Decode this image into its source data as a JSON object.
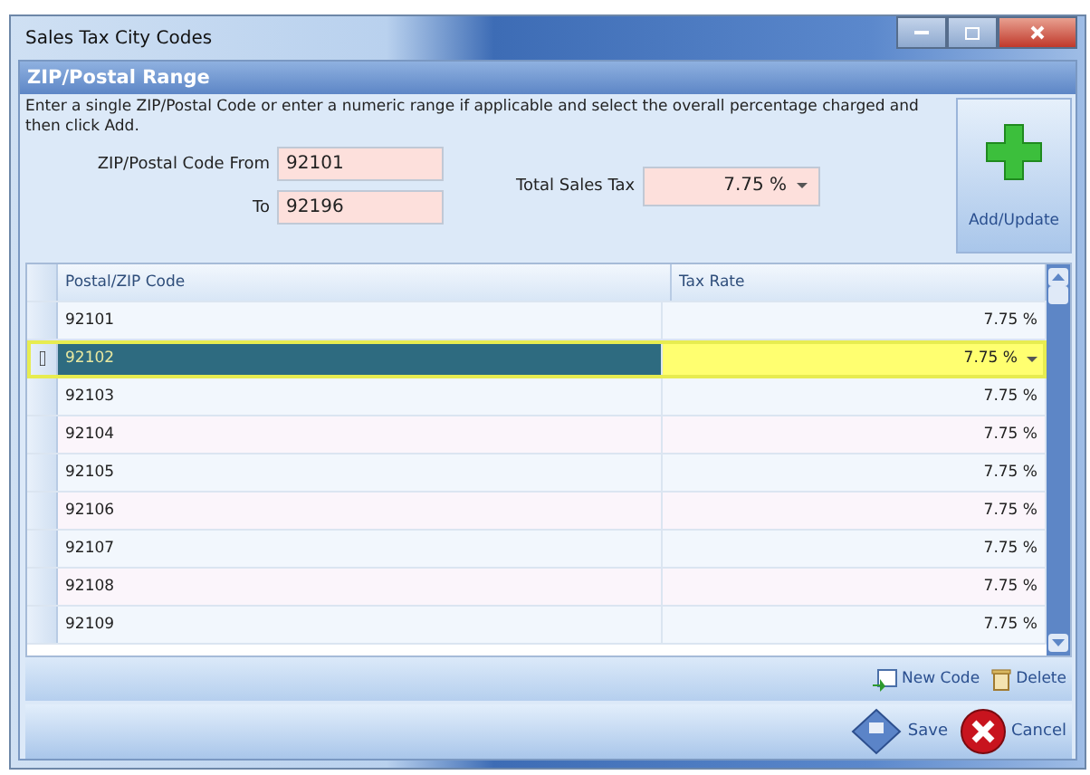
{
  "window": {
    "title": "Sales Tax City Codes"
  },
  "group": {
    "title": "ZIP/Postal Range",
    "description": "Enter a single ZIP/Postal Code or enter a numeric range if applicable and select the overall percentage charged and then click Add."
  },
  "fields": {
    "from_label": "ZIP/Postal Code From",
    "from_value": "92101",
    "to_label": "To",
    "to_value": "92196",
    "tax_label": "Total Sales Tax",
    "tax_value": "7.75 %"
  },
  "add_button": "Add/Update",
  "table": {
    "columns": [
      "Postal/ZIP Code",
      "Tax Rate"
    ],
    "rows": [
      {
        "code": "92101",
        "rate": "7.75 %",
        "selected": false
      },
      {
        "code": "92102",
        "rate": "7.75 %",
        "selected": true
      },
      {
        "code": "92103",
        "rate": "7.75 %",
        "selected": false
      },
      {
        "code": "92104",
        "rate": "7.75 %",
        "selected": false
      },
      {
        "code": "92105",
        "rate": "7.75 %",
        "selected": false
      },
      {
        "code": "92106",
        "rate": "7.75 %",
        "selected": false
      },
      {
        "code": "92107",
        "rate": "7.75 %",
        "selected": false
      },
      {
        "code": "92108",
        "rate": "7.75 %",
        "selected": false
      },
      {
        "code": "92109",
        "rate": "7.75 %",
        "selected": false
      }
    ]
  },
  "toolbar": [
    "New Code",
    "Delete"
  ],
  "buttons": [
    "Save",
    "Cancel"
  ]
}
